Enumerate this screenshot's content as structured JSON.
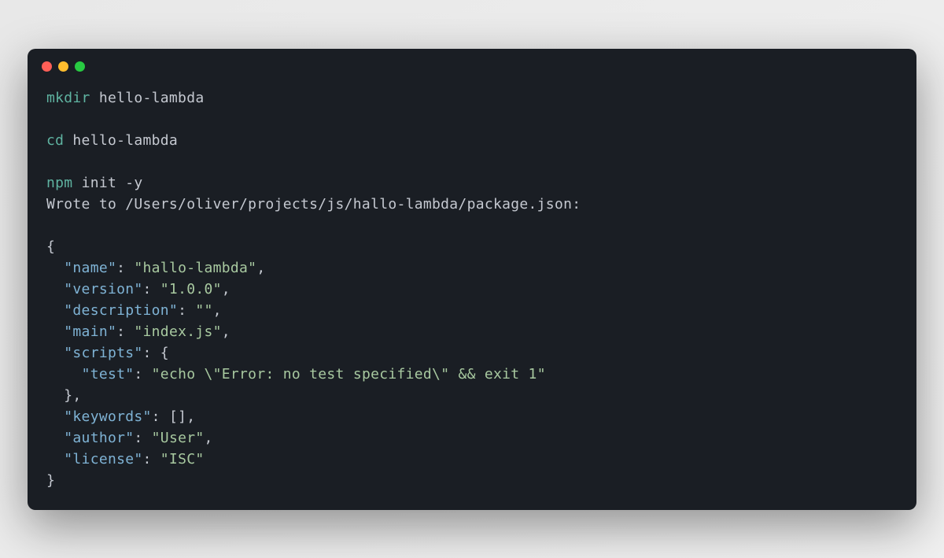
{
  "commands": {
    "mkdir": {
      "cmd": "mkdir",
      "arg": "hello-lambda"
    },
    "cd": {
      "cmd": "cd",
      "arg": "hello-lambda"
    },
    "npm": {
      "cmd": "npm",
      "args": "init -y"
    }
  },
  "output": {
    "wroteLine": "Wrote to /Users/oliver/projects/js/hallo-lambda/package.json:",
    "json": {
      "openBrace": "{",
      "nameKey": "\"name\"",
      "nameVal": "\"hallo-lambda\"",
      "versionKey": "\"version\"",
      "versionVal": "\"1.0.0\"",
      "descriptionKey": "\"description\"",
      "descriptionVal": "\"\"",
      "mainKey": "\"main\"",
      "mainVal": "\"index.js\"",
      "scriptsKey": "\"scripts\"",
      "scriptsOpen": "{",
      "testKey": "\"test\"",
      "testVal": "\"echo \\\"Error: no test specified\\\" && exit 1\"",
      "scriptsClose": "}",
      "keywordsKey": "\"keywords\"",
      "keywordsVal": "[]",
      "authorKey": "\"author\"",
      "authorVal": "\"User\"",
      "licenseKey": "\"license\"",
      "licenseVal": "\"ISC\"",
      "closeBrace": "}"
    }
  },
  "punct": {
    "colon": ": ",
    "comma": ",",
    "indent2": "  ",
    "indent4": "    "
  }
}
